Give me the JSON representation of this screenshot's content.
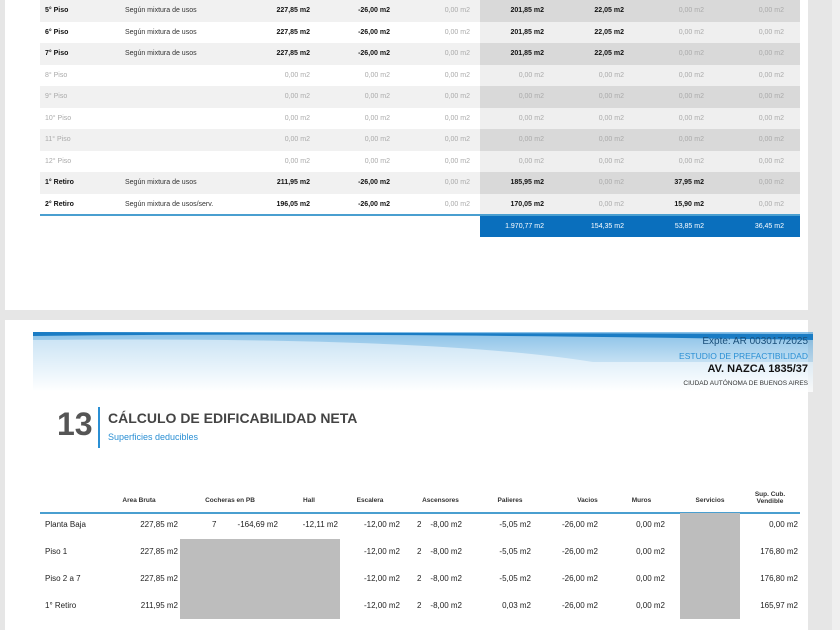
{
  "table1": {
    "rows": [
      {
        "label": "5° Piso",
        "desc": "Según mixtura de usos",
        "v": [
          "227,85 m2",
          "-26,00 m2",
          "0,00 m2",
          "201,85 m2",
          "22,05 m2",
          "0,00 m2",
          "0,00 m2"
        ],
        "bold": [
          true,
          true,
          false,
          true,
          true,
          false,
          false
        ]
      },
      {
        "label": "6° Piso",
        "desc": "Según mixtura de usos",
        "v": [
          "227,85 m2",
          "-26,00 m2",
          "0,00 m2",
          "201,85 m2",
          "22,05 m2",
          "0,00 m2",
          "0,00 m2"
        ],
        "bold": [
          true,
          true,
          false,
          true,
          true,
          false,
          false
        ]
      },
      {
        "label": "7° Piso",
        "desc": "Según mixtura de usos",
        "v": [
          "227,85 m2",
          "-26,00 m2",
          "0,00 m2",
          "201,85 m2",
          "22,05 m2",
          "0,00 m2",
          "0,00 m2"
        ],
        "bold": [
          true,
          true,
          false,
          true,
          true,
          false,
          false
        ]
      },
      {
        "label": "8° Piso",
        "desc": "",
        "v": [
          "0,00 m2",
          "0,00 m2",
          "0,00 m2",
          "0,00 m2",
          "0,00 m2",
          "0,00 m2",
          "0,00 m2"
        ],
        "bold": [
          false,
          false,
          false,
          false,
          false,
          false,
          false
        ]
      },
      {
        "label": "9° Piso",
        "desc": "",
        "v": [
          "0,00 m2",
          "0,00 m2",
          "0,00 m2",
          "0,00 m2",
          "0,00 m2",
          "0,00 m2",
          "0,00 m2"
        ],
        "bold": [
          false,
          false,
          false,
          false,
          false,
          false,
          false
        ]
      },
      {
        "label": "10° Piso",
        "desc": "",
        "v": [
          "0,00 m2",
          "0,00 m2",
          "0,00 m2",
          "0,00 m2",
          "0,00 m2",
          "0,00 m2",
          "0,00 m2"
        ],
        "bold": [
          false,
          false,
          false,
          false,
          false,
          false,
          false
        ]
      },
      {
        "label": "11° Piso",
        "desc": "",
        "v": [
          "0,00 m2",
          "0,00 m2",
          "0,00 m2",
          "0,00 m2",
          "0,00 m2",
          "0,00 m2",
          "0,00 m2"
        ],
        "bold": [
          false,
          false,
          false,
          false,
          false,
          false,
          false
        ]
      },
      {
        "label": "12° Piso",
        "desc": "",
        "v": [
          "0,00 m2",
          "0,00 m2",
          "0,00 m2",
          "0,00 m2",
          "0,00 m2",
          "0,00 m2",
          "0,00 m2"
        ],
        "bold": [
          false,
          false,
          false,
          false,
          false,
          false,
          false
        ]
      },
      {
        "label": "1° Retiro",
        "desc": "Según mixtura de usos",
        "v": [
          "211,95 m2",
          "-26,00 m2",
          "0,00 m2",
          "185,95 m2",
          "0,00 m2",
          "37,95 m2",
          "0,00 m2"
        ],
        "bold": [
          true,
          true,
          false,
          true,
          false,
          true,
          false
        ]
      },
      {
        "label": "2° Retiro",
        "desc": "Según mixtura de usos/serv.",
        "v": [
          "196,05 m2",
          "-26,00 m2",
          "0,00 m2",
          "170,05 m2",
          "0,00 m2",
          "15,90 m2",
          "0,00 m2"
        ],
        "bold": [
          true,
          true,
          false,
          true,
          false,
          true,
          false
        ]
      }
    ],
    "totals": [
      "1.970,77 m2",
      "154,35 m2",
      "53,85 m2",
      "36,45 m2"
    ]
  },
  "header": {
    "expte": "Expte: AR 003017/2025",
    "study": "ESTUDIO DE PREFACTIBILIDAD",
    "address": "AV. NAZCA 1835/37",
    "city": "CIUDAD AUTÓNOMA DE BUENOS AIRES"
  },
  "section": {
    "number": "13",
    "title": "CÁLCULO DE EDIFICABILIDAD NETA",
    "subtitle": "Superficies deducibles"
  },
  "table2": {
    "headers": [
      "Area Bruta",
      "Cocheras en PB",
      "Hall",
      "Escalera",
      "Ascensores",
      "Palieres",
      "Vacios",
      "Muros",
      "Servicios",
      "Sup. Cub.",
      "Vendible"
    ],
    "rows": [
      {
        "label": "Planta Baja",
        "area": "227,85 m2",
        "coch_n": "7",
        "coch": "-164,69 m2",
        "hall": "-12,11 m2",
        "esc": "-12,00 m2",
        "asc_n": "2",
        "asc": "-8,00 m2",
        "pal": "-5,05 m2",
        "vac": "-26,00 m2",
        "mur": "0,00 m2",
        "sup": "0,00 m2"
      },
      {
        "label": "Piso 1",
        "area": "227,85 m2",
        "coch_n": "",
        "coch": "",
        "hall": "",
        "esc": "-12,00 m2",
        "asc_n": "2",
        "asc": "-8,00 m2",
        "pal": "-5,05 m2",
        "vac": "-26,00 m2",
        "mur": "0,00 m2",
        "sup": "176,80 m2"
      },
      {
        "label": "Piso 2 a 7",
        "area": "227,85 m2",
        "coch_n": "",
        "coch": "",
        "hall": "",
        "esc": "-12,00 m2",
        "asc_n": "2",
        "asc": "-8,00 m2",
        "pal": "-5,05 m2",
        "vac": "-26,00 m2",
        "mur": "0,00 m2",
        "sup": "176,80 m2"
      },
      {
        "label": "1° Retiro",
        "area": "211,95 m2",
        "coch_n": "",
        "coch": "",
        "hall": "",
        "esc": "-12,00 m2",
        "asc_n": "2",
        "asc": "-8,00 m2",
        "pal": "0,03 m2",
        "vac": "-26,00 m2",
        "mur": "0,00 m2",
        "sup": "165,97 m2"
      }
    ]
  },
  "colors": {
    "accent": "#0a6fbd",
    "line": "#4a9fd0"
  }
}
